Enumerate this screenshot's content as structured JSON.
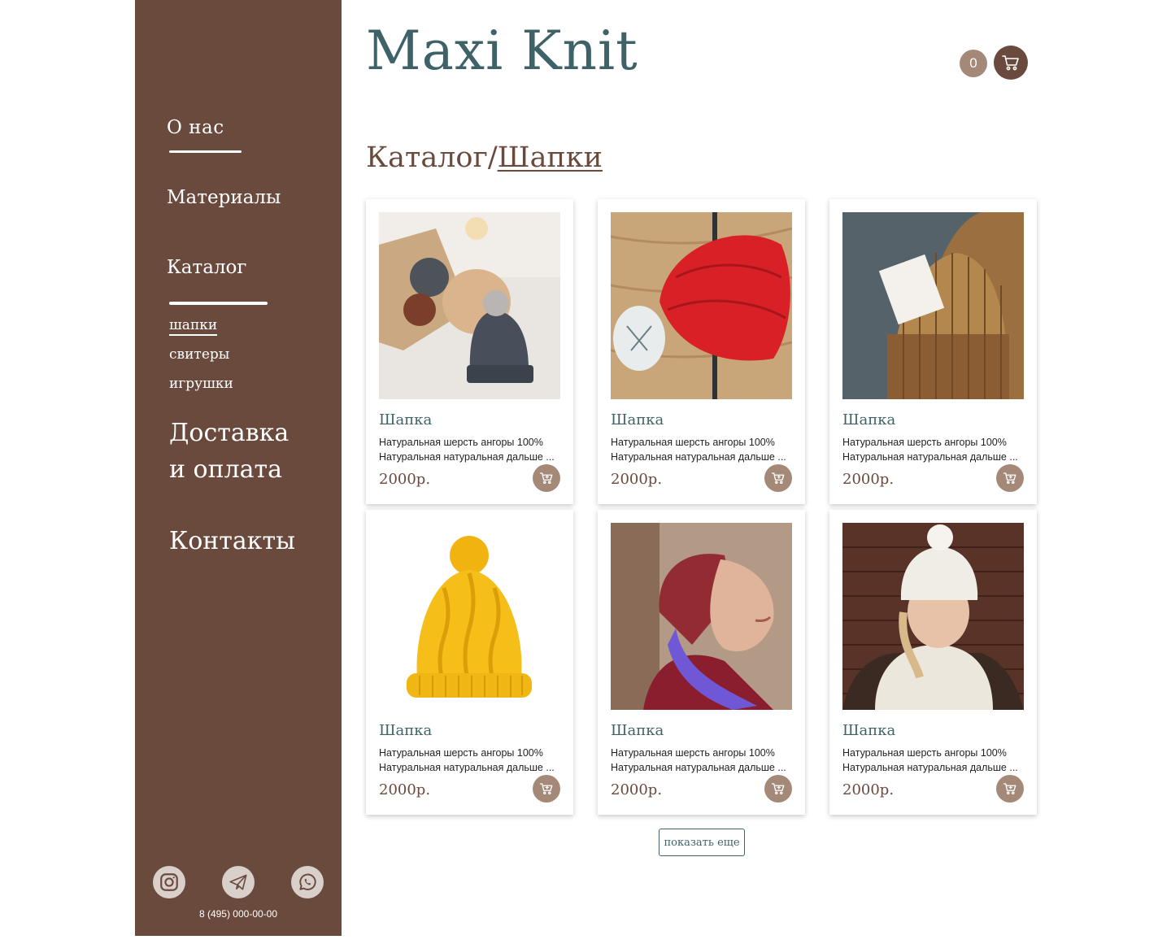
{
  "brand": {
    "logo": "Maxi Knit"
  },
  "cart": {
    "count": "0",
    "icon": "cart-icon"
  },
  "sidebar": {
    "nav": {
      "about": "О нас",
      "materials": "Материалы",
      "catalog": "Каталог",
      "delivery_line1": "Доставка",
      "delivery_line2": "и оплата",
      "contacts": "Контакты"
    },
    "catalog_sub": {
      "hats": "шапки",
      "sweaters": "свитеры",
      "toys": "игрушки"
    },
    "social": [
      "instagram-icon",
      "telegram-icon",
      "whatsapp-icon"
    ],
    "phone": "8 (495) 000-00-00"
  },
  "breadcrumb": {
    "root": "Каталог/",
    "current": "Шапки"
  },
  "products": [
    {
      "title": "Шапка",
      "desc1": "Натуральная шерсть ангоры 100%",
      "desc2": "Натуральная натуральная дальше ...",
      "price": "2000р."
    },
    {
      "title": "Шапка",
      "desc1": "Натуральная шерсть ангоры 100%",
      "desc2": "Натуральная натуральная дальше ...",
      "price": "2000р."
    },
    {
      "title": "Шапка",
      "desc1": "Натуральная шерсть ангоры 100%",
      "desc2": "Натуральная натуральная дальше ...",
      "price": "2000р."
    },
    {
      "title": "Шапка",
      "desc1": "Натуральная шерсть ангоры 100%",
      "desc2": "Натуральная натуральная дальше ...",
      "price": "2000р."
    },
    {
      "title": "Шапка",
      "desc1": "Натуральная шерсть ангоры 100%",
      "desc2": "Натуральная натуральная дальше ...",
      "price": "2000р."
    },
    {
      "title": "Шапка",
      "desc1": "Натуральная шерсть ангоры 100%",
      "desc2": "Натуральная натуральная дальше ...",
      "price": "2000р."
    }
  ],
  "more_button": "показать еще",
  "colors": {
    "sidebar": "#6b4a3e",
    "accent_teal": "#3f6268",
    "accent_tan": "#a48878"
  }
}
